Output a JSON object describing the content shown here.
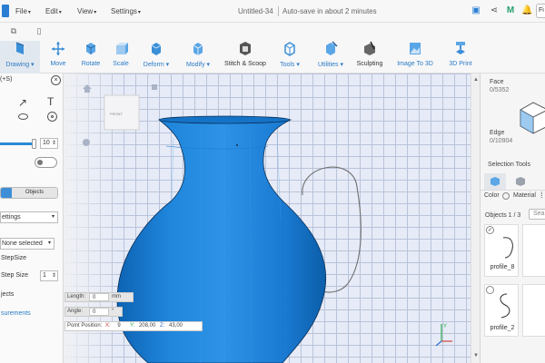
{
  "menu": {
    "file": "File",
    "edit": "Edit",
    "view": "View",
    "settings": "Settings"
  },
  "document": {
    "title": "Untitled-34",
    "autosave": "Auto-save in about 2 minutes"
  },
  "titlebar": {
    "right_button_fragment": "Fi"
  },
  "toolbar": {
    "drawing": "Drawing",
    "move": "Move",
    "rotate": "Rotate",
    "scale": "Scale",
    "deform": "Deform",
    "modify": "Modify",
    "stitch_scoop": "Stitch & Scoop",
    "tools": "Tools",
    "utilities": "Utilities",
    "sculpting": "Sculpting",
    "image_to_3d": "Image To 3D",
    "print_3d": "3D Print"
  },
  "left_panel": {
    "title_fragment": "(+S)",
    "slider_value": "10",
    "seg_objects": "Objects",
    "settings_select": "ettings",
    "none_selected": "None selected",
    "stepsize": "StepSize",
    "step_size_label": "Step Size",
    "step_size_value": "1",
    "objects_fragment": "jects",
    "measurements_fragment": "surements"
  },
  "viewport": {
    "viewcube_front": "FRONT",
    "length_label": "Length:",
    "length_value": "0",
    "length_unit": "mm",
    "angle_label": "Angle:",
    "angle_value": "0",
    "angle_unit": "°",
    "point_label": "Point Position:",
    "x_label": "X:",
    "x_value": "9",
    "y_label": "Y:",
    "y_value": "208,00",
    "z_label": "Z:",
    "z_value": "43,00"
  },
  "right_panel": {
    "face_label": "Face",
    "face_count": "0/5352",
    "edge_label": "Edge",
    "edge_count": "0/10904",
    "selection_tools": "Selection Tools",
    "color_label": "Color",
    "material_label": "Material",
    "objects_count": "Objects 1 / 3",
    "search_fragment": "Sea",
    "items": [
      {
        "name": "profile_8"
      },
      {
        "name": "profile_2"
      }
    ]
  },
  "colors": {
    "accent": "#2b7bc4",
    "vase": "#1e7fd6",
    "grid_bg": "#e6ebf7",
    "grid_line": "#b9c3d9"
  }
}
